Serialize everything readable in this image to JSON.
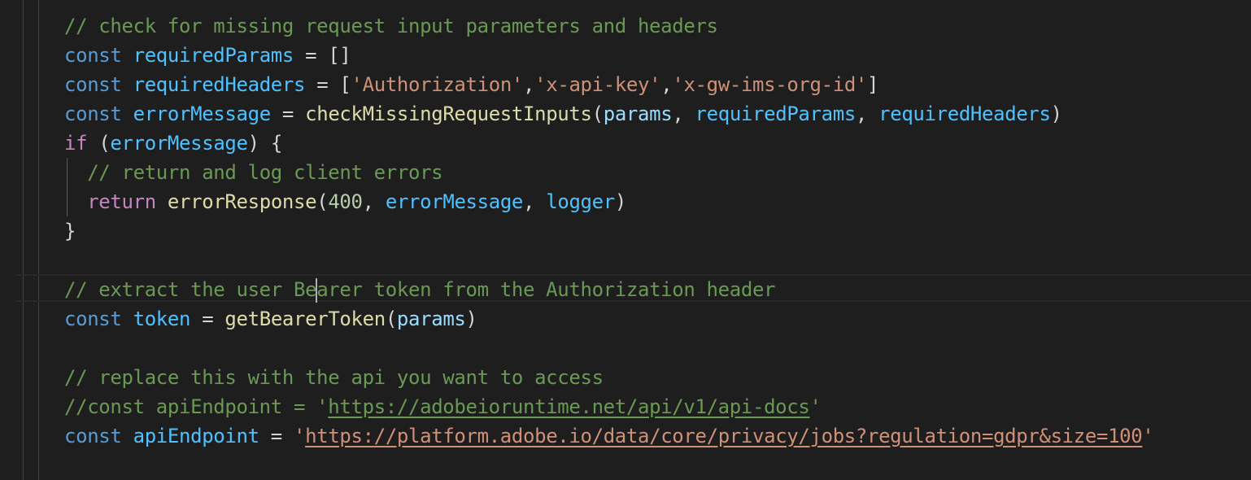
{
  "editor": {
    "colors": {
      "background": "#1e1e1e",
      "comment": "#6a9955",
      "keyword": "#569cd6",
      "control": "#c586c0",
      "constant": "#4fc1ff",
      "variable": "#9cdcfe",
      "function": "#dcdcaa",
      "string": "#ce9178",
      "number": "#b5cea8",
      "cursor": "#aeafad"
    },
    "lines": [
      {
        "l1_comment": "// check for missing request input parameters and headers"
      },
      {
        "kw": "const",
        "name": "requiredParams",
        "eq": " = ",
        "value": "[]"
      },
      {
        "kw": "const",
        "name": "requiredHeaders",
        "eq": " = ",
        "open": "[",
        "s1": "'Authorization'",
        "c1": ",",
        "s2": "'x-api-key'",
        "c2": ",",
        "s3": "'x-gw-ims-org-id'",
        "close": "]"
      },
      {
        "kw": "const",
        "name": "errorMessage",
        "eq": " = ",
        "func": "checkMissingRequestInputs",
        "open": "(",
        "a1": "params",
        "c1": ", ",
        "a2": "requiredParams",
        "c2": ", ",
        "a3": "requiredHeaders",
        "close": ")"
      },
      {
        "kw": "if",
        "sp": " ",
        "open": "(",
        "cond": "errorMessage",
        "close": ")",
        "brace": " {"
      },
      {
        "indent": "  ",
        "comment": "// return and log client errors"
      },
      {
        "indent": "  ",
        "kw": "return",
        "sp": " ",
        "func": "errorResponse",
        "open": "(",
        "num": "400",
        "c1": ", ",
        "a1": "errorMessage",
        "c2": ", ",
        "a2": "logger",
        "close": ")"
      },
      {
        "brace": "}"
      },
      {
        "empty": ""
      },
      {
        "comment_before_cursor": "// extract the user Be",
        "comment_after_cursor": "arer token from the Authorization header"
      },
      {
        "kw": "const",
        "name": "token",
        "eq": " = ",
        "func": "getBearerToken",
        "open": "(",
        "arg": "params",
        "close": ")"
      },
      {
        "empty": ""
      },
      {
        "comment": "// replace this with the api you want to access"
      },
      {
        "prefix": "//const apiEndpoint = '",
        "url": "https://adobeioruntime.net/api/v1/api-docs",
        "suffix": "'"
      },
      {
        "kw": "const",
        "name": "apiEndpoint",
        "eq": " = ",
        "q1": "'",
        "url": "https://platform.adobe.io/data/core/privacy/jobs?regulation=gdpr&size=100",
        "q2": "'"
      }
    ]
  }
}
